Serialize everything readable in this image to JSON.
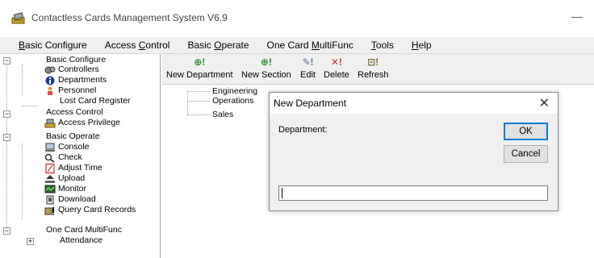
{
  "window": {
    "title": "Contactless Cards Management System  V6.9",
    "minimize_glyph": "—",
    "icon": "app-card-reader-icon"
  },
  "menu": [
    {
      "label": "Basic Configure",
      "mnemonic": "B"
    },
    {
      "label": "Access Control",
      "mnemonic": "C"
    },
    {
      "label": "Basic Operate",
      "mnemonic": "O"
    },
    {
      "label": "One Card MultiFunc",
      "mnemonic": "M"
    },
    {
      "label": "Tools",
      "mnemonic": "T"
    },
    {
      "label": "Help",
      "mnemonic": "H"
    }
  ],
  "tree": {
    "groups": [
      {
        "label": "Basic Configure",
        "expander": "−",
        "items": [
          {
            "label": "Controllers",
            "icon": "controllers-icon"
          },
          {
            "label": "Departments",
            "icon": "departments-icon"
          },
          {
            "label": "Personnel",
            "icon": "personnel-icon"
          },
          {
            "label": "Lost Card Register",
            "icon": ""
          }
        ]
      },
      {
        "label": "Access Control",
        "expander": "−",
        "items": [
          {
            "label": "Access Privilege",
            "icon": "access-privilege-icon"
          }
        ]
      },
      {
        "label": "Basic Operate",
        "expander": "−",
        "items": [
          {
            "label": "Console",
            "icon": "console-icon"
          },
          {
            "label": "Check",
            "icon": "check-icon"
          },
          {
            "label": "Adjust Time",
            "icon": "adjust-time-icon"
          },
          {
            "label": "Upload",
            "icon": "upload-icon"
          },
          {
            "label": "Monitor",
            "icon": "monitor-icon"
          },
          {
            "label": "Download",
            "icon": "download-icon"
          },
          {
            "label": "Query Card Records",
            "icon": "query-records-icon"
          }
        ]
      },
      {
        "label": "One Card MultiFunc",
        "expander": "−",
        "items": [
          {
            "label": "Attendance",
            "icon": "",
            "expander": "+"
          }
        ]
      }
    ]
  },
  "toolbar": [
    {
      "label": "New Department",
      "icon": "new-department-icon",
      "glyph": "⊕!"
    },
    {
      "label": "New Section",
      "icon": "new-section-icon",
      "glyph": "⊕!"
    },
    {
      "label": "Edit",
      "icon": "edit-icon",
      "glyph": "✎!"
    },
    {
      "label": "Delete",
      "icon": "delete-icon",
      "glyph": "✕!"
    },
    {
      "label": "Refresh",
      "icon": "refresh-icon",
      "glyph": "⊡!"
    }
  ],
  "departments": [
    "Engineering",
    "Operations",
    "Sales"
  ],
  "dialog": {
    "title": "New Department",
    "close_glyph": "✕",
    "field_label": "Department:",
    "ok_label": "OK",
    "cancel_label": "Cancel",
    "input_value": "",
    "accent": "#0078d7"
  }
}
